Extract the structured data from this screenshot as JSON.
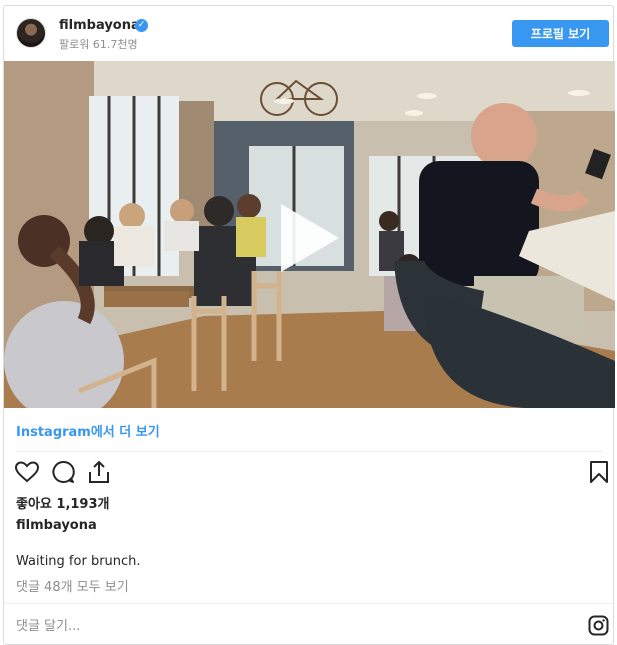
{
  "header": {
    "username": "filmbayona",
    "verified_mark": "✓",
    "followers_text": "팔로워 61.7천명",
    "profile_button_label": "프로필 보기"
  },
  "media": {
    "type": "video",
    "play_icon": "play-icon"
  },
  "view_more_label": "Instagram에서 더 보기",
  "actions": {
    "like_icon": "heart-icon",
    "comment_icon": "comment-icon",
    "share_icon": "share-icon",
    "save_icon": "bookmark-icon"
  },
  "likes_text": "좋아요 1,193개",
  "author": "filmbayona",
  "caption": "Waiting for brunch.",
  "view_comments_text": "댓글 48개 모두 보기",
  "comment_placeholder": "댓글 달기...",
  "footer_icon": "instagram-icon"
}
